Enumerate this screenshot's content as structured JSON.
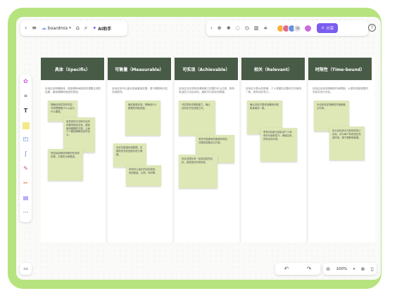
{
  "toolbar_left": {
    "back_icon": "chevron-left-icon",
    "menu_icon": "hamburger-icon",
    "brand": "boardmix",
    "ai_label": "AI助手"
  },
  "toolbar_right": {
    "more_count": "99",
    "share_label": "分享",
    "help": "?"
  },
  "columns": [
    {
      "title": "具体（Specific）",
      "desc": "目标应该明确具体，能够清晰地描述你想要达成的结果，避免模糊和笼统的表述。"
    },
    {
      "title": "可衡量（Measurable）",
      "desc": "目标应该可以量化或者衡量进展，便于跟踪和评估完成情况。"
    },
    {
      "title": "可实现（Achievable）",
      "desc": "目标应当在现有资源和能力范围内可以达成，既有挑战性又切合实际，避免不切实际的期望。"
    },
    {
      "title": "相关（Relevant）",
      "desc": "目标应与更大的愿景、个人或团队的整体方向保持一致，具有实际意义。"
    },
    {
      "title": "时限性（Time-bound）",
      "desc": "目标应该设定明确的时间限制，以便在规定期限内完成并进行评估。"
    }
  ],
  "notes": [
    "明确目标的具体内容，写清楚要做什么以及为什么要做。",
    "用具体的行动和可见的成果来描述目标，避免使用模糊的词语，让每个人都能理解目标的含义。",
    "把目标拆解成清晰的任务和步骤，方便执行和跟进。",
    "确定衡量标准，明确用什么数据来判断进度。",
    "设定关键指标和数据，定期检查完成进度并进行调整。",
    "采用可以量化的目标描述，例如数量、比例、时间等。",
    "评估现有资源和能力，确认目标在可控范围之内。",
    "考虑可能遇到的困难和风险，并提前准备应对方案。",
    "设定合理且有一定挑战性的目标，激发团队的积极性。",
    "确认目标与整体战略和长期愿景保持一致。",
    "思考目标能为团队或个人带来的价值和意义，确保目标具有实际作用。",
    "为目标设定明确的开始和截止时间。",
    "将大目标拆分为阶段性的小目标，并为每个阶段设定完成时间，便于跟踪和管理。"
  ],
  "zoom": {
    "value": "100%"
  }
}
